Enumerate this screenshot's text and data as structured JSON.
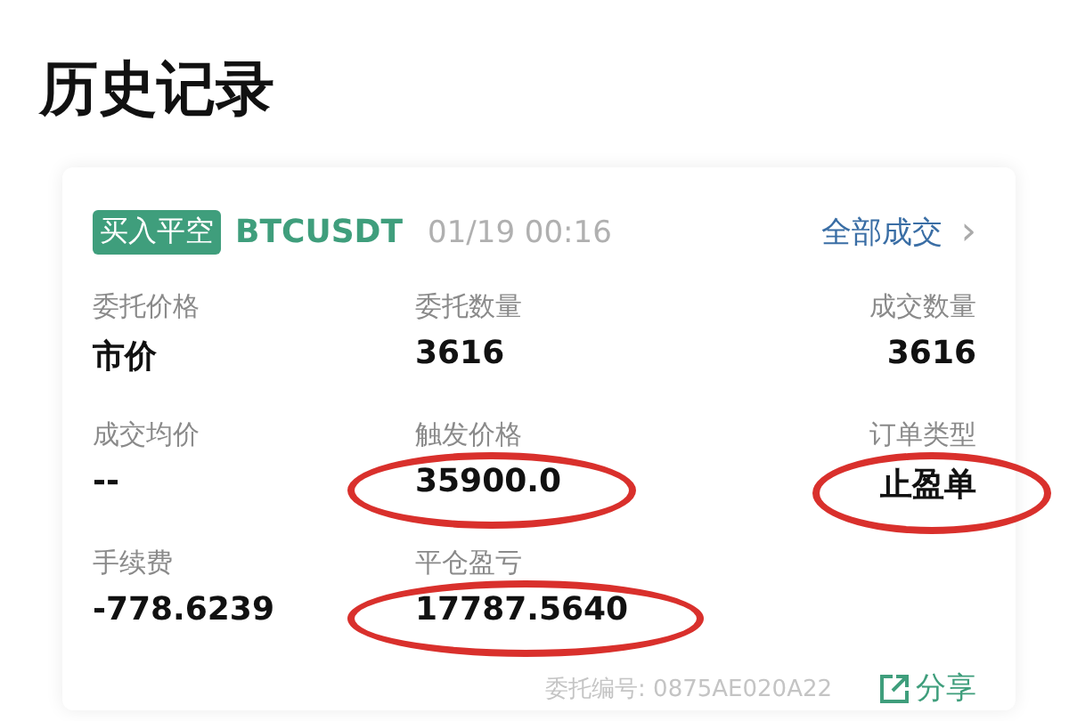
{
  "page_title": "历史记录",
  "order": {
    "side_badge": "买入平空",
    "symbol": "BTCUSDT",
    "time": "01/19 00:16",
    "all_trades_link": "全部成交",
    "chevron": "›",
    "fields": [
      {
        "label": "委托价格",
        "value": "市价",
        "circled": false
      },
      {
        "label": "委托数量",
        "value": "3616",
        "circled": false
      },
      {
        "label": "成交数量",
        "value": "3616",
        "circled": false
      },
      {
        "label": "成交均价",
        "value": "--",
        "circled": false
      },
      {
        "label": "触发价格",
        "value": "35900.0",
        "circled": true
      },
      {
        "label": "订单类型",
        "value": "止盈单",
        "circled": true
      },
      {
        "label": "手续费",
        "value": "-778.6239",
        "circled": false
      },
      {
        "label": "平仓盈亏",
        "value": "17787.5640",
        "circled": true
      }
    ],
    "order_id": "委托编号: 0875AE020A22",
    "share": "分享"
  }
}
